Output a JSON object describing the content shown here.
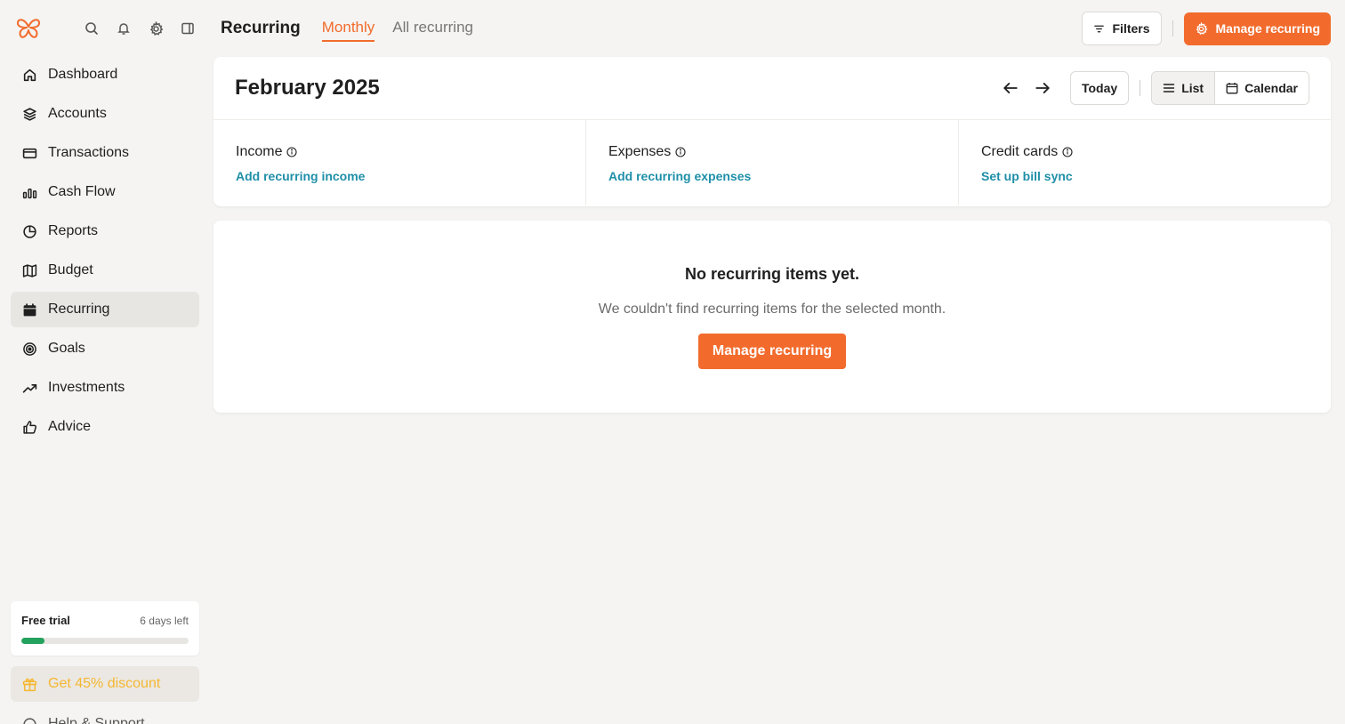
{
  "sidebar": {
    "logo_icon": "butterfly-logo-icon",
    "top_icons": [
      "search-icon",
      "bell-icon",
      "gear-icon",
      "sidebar-toggle-icon"
    ],
    "items": [
      {
        "label": "Dashboard",
        "icon": "home-icon"
      },
      {
        "label": "Accounts",
        "icon": "layers-icon"
      },
      {
        "label": "Transactions",
        "icon": "credit-card-icon"
      },
      {
        "label": "Cash Flow",
        "icon": "bar-chart-icon"
      },
      {
        "label": "Reports",
        "icon": "pie-chart-icon"
      },
      {
        "label": "Budget",
        "icon": "map-icon"
      },
      {
        "label": "Recurring",
        "icon": "calendar-icon",
        "active": true
      },
      {
        "label": "Goals",
        "icon": "target-icon"
      },
      {
        "label": "Investments",
        "icon": "trending-up-icon"
      },
      {
        "label": "Advice",
        "icon": "thumbs-up-icon"
      }
    ],
    "trial": {
      "title": "Free trial",
      "days_left": "6 days left",
      "progress": 0.14
    },
    "discount_label": "Get 45% discount",
    "help_label": "Help & Support"
  },
  "header": {
    "title": "Recurring",
    "tabs": [
      {
        "label": "Monthly",
        "active": true
      },
      {
        "label": "All recurring",
        "active": false
      }
    ],
    "filters_label": "Filters",
    "manage_label": "Manage recurring"
  },
  "month": {
    "title": "February 2025",
    "today_label": "Today",
    "list_label": "List",
    "calendar_label": "Calendar"
  },
  "summary": [
    {
      "label": "Income",
      "link": "Add recurring income"
    },
    {
      "label": "Expenses",
      "link": "Add recurring expenses"
    },
    {
      "label": "Credit cards",
      "link": "Set up bill sync"
    }
  ],
  "empty": {
    "title": "No recurring items yet.",
    "subtitle": "We couldn't find recurring items for the selected month.",
    "button": "Manage recurring"
  },
  "colors": {
    "accent": "#f26b2d",
    "link": "#1f8fa8",
    "progress": "#23a25d",
    "discount": "#f5b731"
  }
}
